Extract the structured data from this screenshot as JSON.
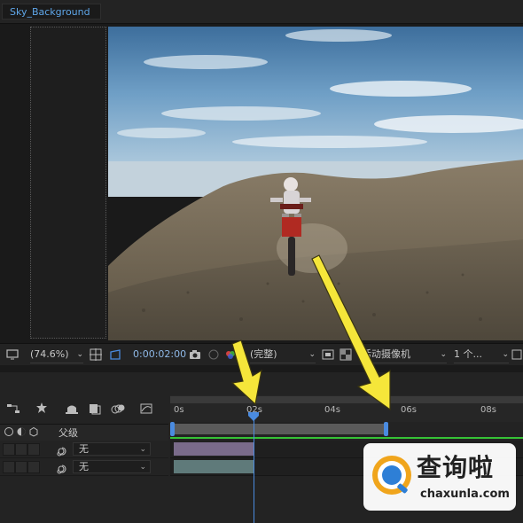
{
  "composition_tab": {
    "label": "Sky_Background"
  },
  "viewer_toolbar": {
    "zoom": "(74.6%)",
    "timecode": "0:00:02:00",
    "resolution": "(完整)",
    "camera": "活动摄像机",
    "views": "1 个..."
  },
  "timeline": {
    "ruler_labels": [
      "0s",
      "02s",
      "04s",
      "06s",
      "08s"
    ],
    "header": {
      "parent_label": "父级"
    },
    "layers": [
      {
        "parent": "无"
      },
      {
        "parent": "无"
      }
    ],
    "playhead_time": "02s"
  },
  "annotations": {
    "arrow_color": "#f5e63a"
  },
  "colors": {
    "accent": "#4a8be0",
    "work_area_green": "#36c236"
  },
  "watermark": {
    "main": "查询啦",
    "sub": "chaxunla.com"
  }
}
